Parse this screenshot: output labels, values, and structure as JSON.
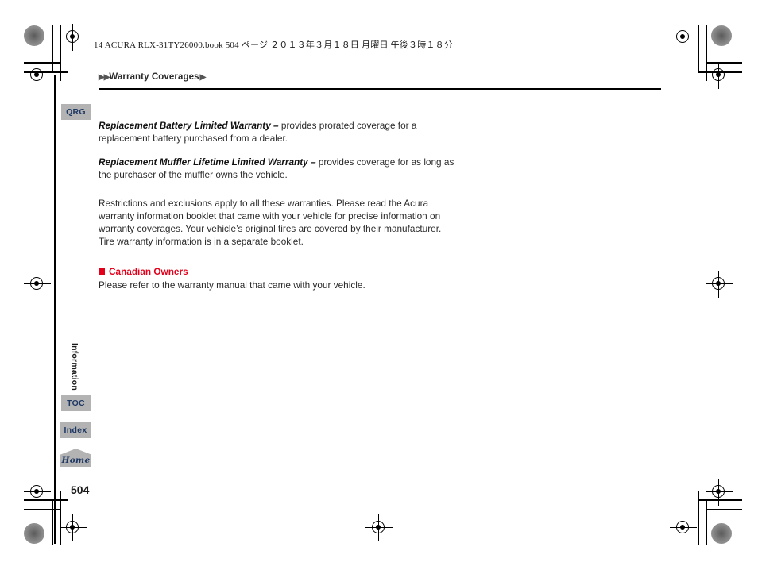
{
  "print_header": {
    "text": "14 ACURA RLX-31TY26000.book    504 ページ    ２０１３年３月１８日    月曜日    午後３時１８分"
  },
  "breadcrumb": {
    "marker_start": "▶▶",
    "label": "Warranty Coverages",
    "marker_end": "▶"
  },
  "tabs": {
    "qrg": "QRG",
    "toc": "TOC",
    "index": "Index",
    "home": "Home"
  },
  "section_label": "Information",
  "page_number": "504",
  "content": {
    "paragraphs": [
      {
        "lead": "Replacement Battery Limited Warranty – ",
        "body": "provides prorated coverage for a replacement battery purchased from a dealer."
      },
      {
        "lead": "Replacement Muffler Lifetime Limited Warranty – ",
        "body": "provides coverage for as long as the purchaser of the muffler owns the vehicle."
      },
      {
        "lead": "",
        "body": "Restrictions and exclusions apply to all these warranties. Please read the Acura warranty information booklet that came with your vehicle for precise information on warranty coverages. Your vehicle’s original tires are covered by their manufacturer. Tire warranty information is in a separate booklet."
      }
    ],
    "subsection": {
      "heading": "Canadian Owners",
      "body": "Please refer to the warranty manual that came with your vehicle."
    }
  },
  "colors": {
    "accent_red": "#e3001b",
    "tab_background": "#b3b3b3",
    "tab_text": "#1f3864",
    "body_text": "#2b2b2b"
  }
}
